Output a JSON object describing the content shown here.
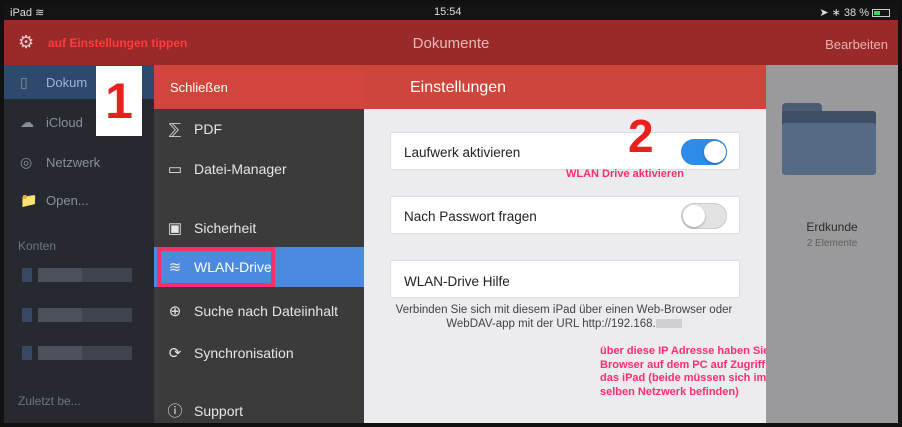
{
  "status_bar": {
    "device": "iPad",
    "wifi": "wifi-icon",
    "time": "15:54",
    "battery": "38 %"
  },
  "top_nav": {
    "title": "Dokumente",
    "edit_label": "Bearbeiten",
    "annotation": "auf Einstellungen tippen"
  },
  "sidebar": {
    "items": [
      {
        "label": "Dokum",
        "icon": "document-icon",
        "active": true
      },
      {
        "label": "iCloud",
        "icon": "cloud-icon",
        "active": false
      },
      {
        "label": "Netzwerk",
        "icon": "network-icon",
        "active": false
      },
      {
        "label": "Open...",
        "icon": "folder-icon",
        "active": false
      }
    ],
    "section_accounts": "Konten",
    "section_recent": "Zuletzt be..."
  },
  "step_numbers": {
    "one": "1",
    "two": "2"
  },
  "menu": {
    "close_label": "Schließen",
    "items": [
      {
        "label": "PDF",
        "icon": "pdf-icon"
      },
      {
        "label": "Datei-Manager",
        "icon": "folder-icon"
      },
      {
        "label": "Sicherheit",
        "icon": "lock-icon"
      },
      {
        "label": "WLAN-Drive",
        "icon": "wifi-icon",
        "active": true
      },
      {
        "label": "Suche nach Dateiinhalt",
        "icon": "search-content-icon"
      },
      {
        "label": "Synchronisation",
        "icon": "sync-icon"
      },
      {
        "label": "Support",
        "icon": "help-icon"
      }
    ]
  },
  "settings": {
    "title": "Einstellungen",
    "rows": [
      {
        "label": "Laufwerk aktivieren",
        "toggle": true
      },
      {
        "label": "Nach Passwort fragen",
        "toggle": false
      },
      {
        "label": "WLAN-Drive Hilfe"
      }
    ],
    "help_text": "Verbinden Sie sich mit diesem iPad über einen Web-Browser oder WebDAV-app mit der URL http://192.168.",
    "annotation_toggle": "WLAN Drive aktivieren",
    "annotation_ip": "über diese IP Adresse haben Sie im Browser auf dem PC auf Zugriff auf das iPad (beide müssen sich im selben Netzwerk befinden)"
  },
  "documents": {
    "folder_name": "Erdkunde",
    "folder_count": "2 Elemente"
  },
  "colors": {
    "accent_red": "#cd453b",
    "nav_red": "#9a2a2a",
    "active_blue": "#4a8bdf",
    "toggle_on": "#2e8be8",
    "annotation_pink": "#ff2d6e"
  }
}
